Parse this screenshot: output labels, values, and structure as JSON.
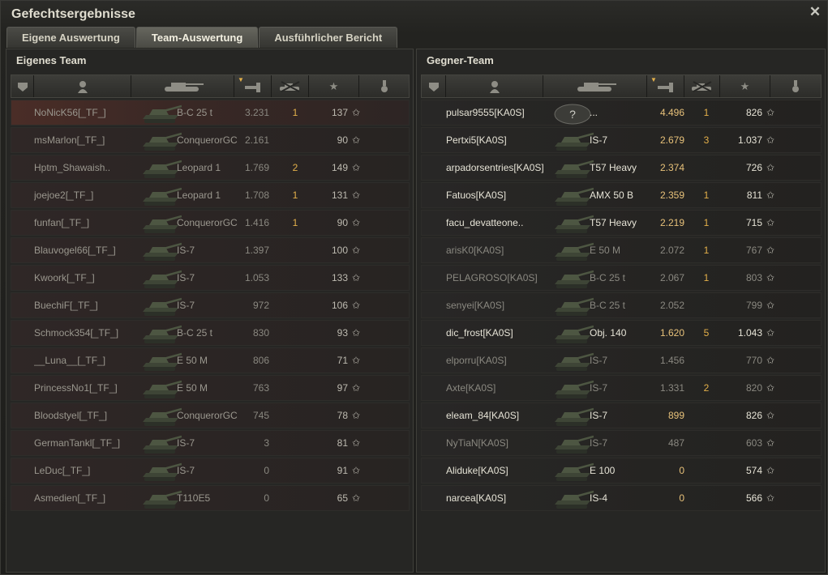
{
  "window": {
    "title": "Gefechtsergebnisse"
  },
  "tabs": [
    "Eigene Auswertung",
    "Team-Auswertung",
    "Ausführlicher Bericht"
  ],
  "active_tab": 1,
  "columns": [
    "squad",
    "player",
    "vehicle",
    "damage",
    "kills",
    "xp",
    "medal"
  ],
  "own_team": {
    "title": "Eigenes Team",
    "players": [
      {
        "name": "NoNicK56[_TF_]",
        "vehicle": "B-C 25 t",
        "damage": "3.231",
        "kills": "1",
        "xp": "137",
        "highlight": true
      },
      {
        "name": "msMarlon[_TF_]",
        "vehicle": "ConquerorGC",
        "damage": "2.161",
        "kills": "",
        "xp": "90"
      },
      {
        "name": "Hptm_Shawaish..",
        "vehicle": "Leopard 1",
        "damage": "1.769",
        "kills": "2",
        "xp": "149"
      },
      {
        "name": "joejoe2[_TF_]",
        "vehicle": "Leopard 1",
        "damage": "1.708",
        "kills": "1",
        "xp": "131"
      },
      {
        "name": "funfan[_TF_]",
        "vehicle": "ConquerorGC",
        "damage": "1.416",
        "kills": "1",
        "xp": "90"
      },
      {
        "name": "Blauvogel66[_TF_]",
        "vehicle": "IS-7",
        "damage": "1.397",
        "kills": "",
        "xp": "100"
      },
      {
        "name": "Kwoork[_TF_]",
        "vehicle": "IS-7",
        "damage": "1.053",
        "kills": "",
        "xp": "133"
      },
      {
        "name": "BuechiF[_TF_]",
        "vehicle": "IS-7",
        "damage": "972",
        "kills": "",
        "xp": "106"
      },
      {
        "name": "Schmock354[_TF_]",
        "vehicle": "B-C 25 t",
        "damage": "830",
        "kills": "",
        "xp": "93"
      },
      {
        "name": "__Luna__[_TF_]",
        "vehicle": "E 50 M",
        "damage": "806",
        "kills": "",
        "xp": "71"
      },
      {
        "name": "PrincessNo1[_TF_]",
        "vehicle": "E 50 M",
        "damage": "763",
        "kills": "",
        "xp": "97"
      },
      {
        "name": "Bloodstyel[_TF_]",
        "vehicle": "ConquerorGC",
        "damage": "745",
        "kills": "",
        "xp": "78"
      },
      {
        "name": "GermanTankl[_TF_]",
        "vehicle": "IS-7",
        "damage": "3",
        "kills": "",
        "xp": "81"
      },
      {
        "name": "LeDuc[_TF_]",
        "vehicle": "IS-7",
        "damage": "0",
        "kills": "",
        "xp": "91"
      },
      {
        "name": "Asmedien[_TF_]",
        "vehicle": "T110E5",
        "damage": "0",
        "kills": "",
        "xp": "65"
      }
    ]
  },
  "enemy_team": {
    "title": "Gegner-Team",
    "players": [
      {
        "name": "pulsar9555[KA0S]",
        "vehicle": "...",
        "damage": "4.496",
        "kills": "1",
        "xp": "826",
        "alive": true,
        "unknown": true
      },
      {
        "name": "Pertxi5[KA0S]",
        "vehicle": "IS-7",
        "damage": "2.679",
        "kills": "3",
        "xp": "1.037",
        "alive": true
      },
      {
        "name": "arpadorsentries[KA0S]",
        "vehicle": "T57 Heavy",
        "damage": "2.374",
        "kills": "",
        "xp": "726",
        "alive": true
      },
      {
        "name": "Fatuos[KA0S]",
        "vehicle": "AMX 50 B",
        "damage": "2.359",
        "kills": "1",
        "xp": "811",
        "alive": true
      },
      {
        "name": "facu_devatteone..",
        "vehicle": "T57 Heavy",
        "damage": "2.219",
        "kills": "1",
        "xp": "715",
        "alive": true
      },
      {
        "name": "arisK0[KA0S]",
        "vehicle": "E 50 M",
        "damage": "2.072",
        "kills": "1",
        "xp": "767",
        "dim": true
      },
      {
        "name": "PELAGROSO[KA0S]",
        "vehicle": "B-C 25 t",
        "damage": "2.067",
        "kills": "1",
        "xp": "803",
        "dim": true
      },
      {
        "name": "senyei[KA0S]",
        "vehicle": "B-C 25 t",
        "damage": "2.052",
        "kills": "",
        "xp": "799",
        "dim": true
      },
      {
        "name": "dic_frost[KA0S]",
        "vehicle": "Obj. 140",
        "damage": "1.620",
        "kills": "5",
        "xp": "1.043",
        "alive": true
      },
      {
        "name": "elporru[KA0S]",
        "vehicle": "IS-7",
        "damage": "1.456",
        "kills": "",
        "xp": "770",
        "dim": true
      },
      {
        "name": "Axte[KA0S]",
        "vehicle": "IS-7",
        "damage": "1.331",
        "kills": "2",
        "xp": "820",
        "dim": true
      },
      {
        "name": "eleam_84[KA0S]",
        "vehicle": "IS-7",
        "damage": "899",
        "kills": "",
        "xp": "826",
        "alive": true
      },
      {
        "name": "NyTiaN[KA0S]",
        "vehicle": "IS-7",
        "damage": "487",
        "kills": "",
        "xp": "603",
        "dim": true
      },
      {
        "name": "Aliduke[KA0S]",
        "vehicle": "E 100",
        "damage": "0",
        "kills": "",
        "xp": "574",
        "alive": true
      },
      {
        "name": "narcea[KA0S]",
        "vehicle": "IS-4",
        "damage": "0",
        "kills": "",
        "xp": "566",
        "alive": true
      }
    ]
  },
  "star_glyph": "✩",
  "colors": {
    "kills": "#e3b04a",
    "highlight_row": "#4a2d27",
    "enemy_damage": "#e8c27a"
  }
}
